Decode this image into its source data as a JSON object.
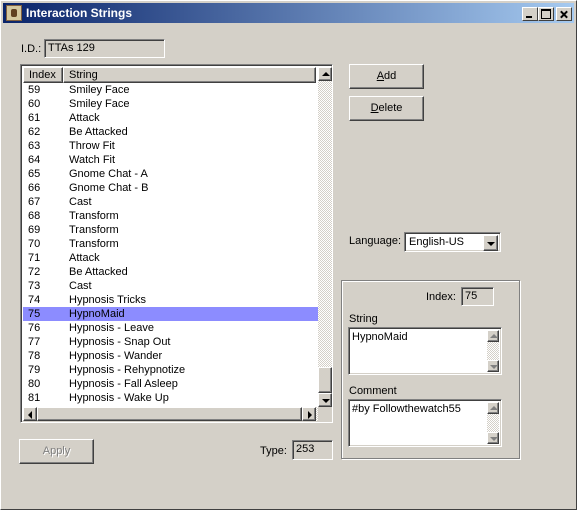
{
  "window": {
    "title": "Interaction Strings",
    "icon": "app-icon"
  },
  "id_field": {
    "label": "I.D.:",
    "value": "TTAs 129"
  },
  "list": {
    "columns": [
      "Index",
      "String"
    ],
    "rows": [
      {
        "index": "59",
        "string": "Smiley Face"
      },
      {
        "index": "60",
        "string": "Smiley Face"
      },
      {
        "index": "61",
        "string": "Attack"
      },
      {
        "index": "62",
        "string": "Be Attacked"
      },
      {
        "index": "63",
        "string": "Throw Fit"
      },
      {
        "index": "64",
        "string": "Watch Fit"
      },
      {
        "index": "65",
        "string": "Gnome Chat - A"
      },
      {
        "index": "66",
        "string": "Gnome Chat - B"
      },
      {
        "index": "67",
        "string": "Cast"
      },
      {
        "index": "68",
        "string": "Transform"
      },
      {
        "index": "69",
        "string": "Transform"
      },
      {
        "index": "70",
        "string": "Transform"
      },
      {
        "index": "71",
        "string": "Attack"
      },
      {
        "index": "72",
        "string": "Be Attacked"
      },
      {
        "index": "73",
        "string": "Cast"
      },
      {
        "index": "74",
        "string": "Hypnosis Tricks"
      },
      {
        "index": "75",
        "string": "HypnoMaid"
      },
      {
        "index": "76",
        "string": "Hypnosis - Leave"
      },
      {
        "index": "77",
        "string": "Hypnosis - Snap Out"
      },
      {
        "index": "78",
        "string": "Hypnosis - Wander"
      },
      {
        "index": "79",
        "string": "Hypnosis - Rehypnotize"
      },
      {
        "index": "80",
        "string": "Hypnosis - Fall Asleep"
      },
      {
        "index": "81",
        "string": "Hypnosis - Wake Up"
      }
    ],
    "selected_index": "75"
  },
  "buttons": {
    "add_prefix": "",
    "add_accel": "A",
    "add_rest": "dd",
    "delete_prefix": "",
    "delete_accel": "D",
    "delete_rest": "elete",
    "apply": "Apply"
  },
  "language": {
    "label": "Language:",
    "value": "English-US"
  },
  "type_field": {
    "label": "Type:",
    "value": "253"
  },
  "detail": {
    "index_label": "Index:",
    "index_value": "75",
    "string_label": "String",
    "string_value": "HypnoMaid",
    "comment_label": "Comment",
    "comment_value": "#by Followthewatch55"
  },
  "colors": {
    "title_start": "#0a246a",
    "title_end": "#a6caf0",
    "selection": "#8c8cff",
    "face": "#d4d0c8"
  }
}
